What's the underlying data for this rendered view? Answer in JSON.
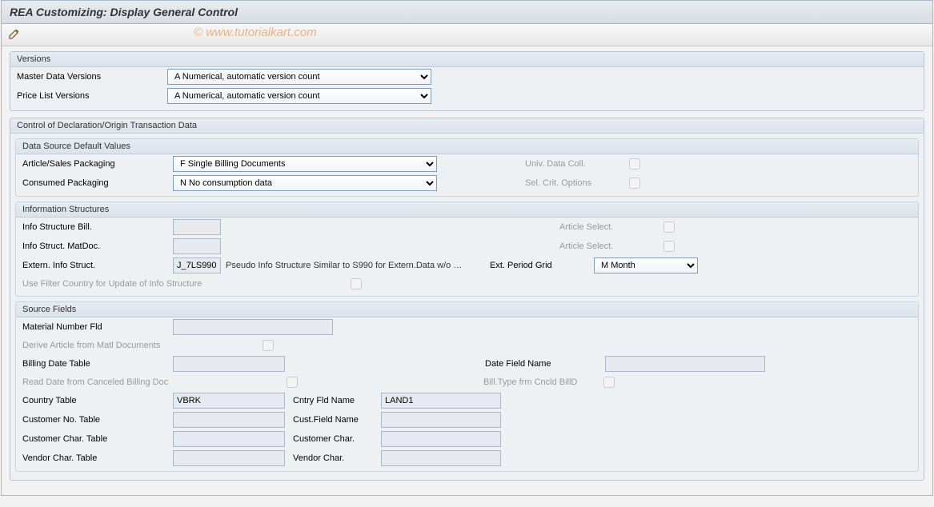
{
  "header": {
    "title": "REA Customizing: Display General Control"
  },
  "watermark": "© www.tutorialkart.com",
  "versions": {
    "title": "Versions",
    "master_label": "Master Data Versions",
    "master_value": "A Numerical, automatic version count",
    "price_label": "Price List Versions",
    "price_value": "A Numerical, automatic version count"
  },
  "control": {
    "title": "Control of Declaration/Origin Transaction Data",
    "defaults": {
      "title": "Data Source Default Values",
      "article_label": "Article/Sales Packaging",
      "article_value": "F Single Billing Documents",
      "univ_label": "Univ. Data Coll.",
      "consumed_label": "Consumed Packaging",
      "consumed_value": "N No consumption data",
      "selcrit_label": "Sel. Crit. Options"
    },
    "info": {
      "title": "Information Structures",
      "bill_label": "Info Structure Bill.",
      "bill_value": "",
      "artsel_label": "Article Select.",
      "matdoc_label": "Info Struct. MatDoc.",
      "matdoc_value": "",
      "extern_label": "Extern. Info Struct.",
      "extern_value": "J_7LS990",
      "extern_desc": "Pseudo Info Structure Similar to S990 for Extern.Data w/o …",
      "extperiod_label": "Ext. Period Grid",
      "extperiod_value": "M Month",
      "filter_label": "Use Filter Country for Update of Info Structure"
    },
    "source": {
      "title": "Source Fields",
      "matnum_label": "Material Number Fld",
      "matnum_value": "",
      "derive_label": "Derive Article from Matl Documents",
      "billtable_label": "Billing Date Table",
      "billtable_value": "",
      "datefield_label": "Date Field Name",
      "datefield_value": "",
      "readdate_label": "Read Date from Canceled Billing Doc",
      "billtype_label": "Bill.Type frm Cncld BillD",
      "country_label": "Country Table",
      "country_value": "VBRK",
      "cntryfld_label": "Cntry Fld Name",
      "cntryfld_value": "LAND1",
      "custno_label": "Customer No. Table",
      "custno_value": "",
      "custfld_label": "Cust.Field Name",
      "custfld_value": "",
      "custchar_label": "Customer Char. Table",
      "custchar_value": "",
      "custchar2_label": "Customer Char.",
      "custchar2_value": "",
      "vendchar_label": "Vendor Char. Table",
      "vendchar_value": "",
      "vendchar2_label": "Vendor Char.",
      "vendchar2_value": ""
    }
  }
}
